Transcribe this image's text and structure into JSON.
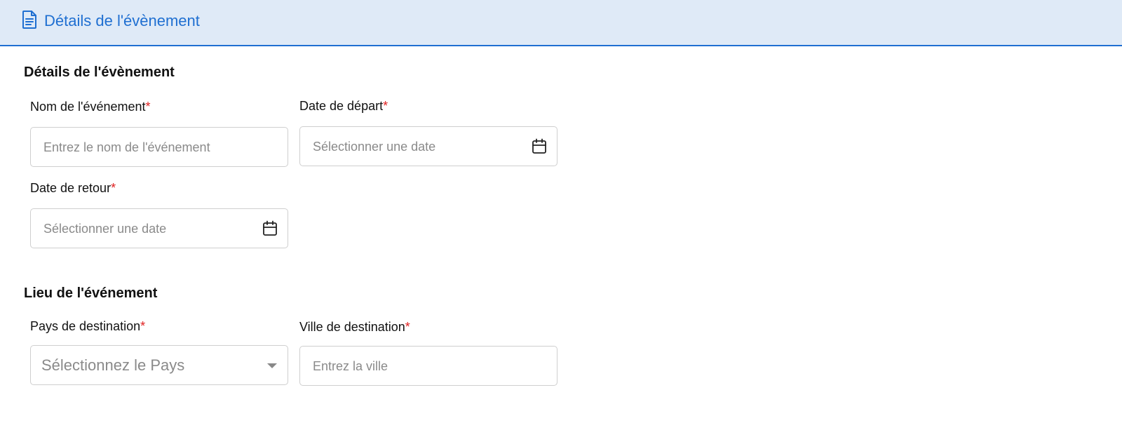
{
  "header": {
    "title": "Détails de l'évènement",
    "icon": "document-icon"
  },
  "sections": {
    "details": {
      "title": "Détails de l'évènement",
      "event_name": {
        "label": "Nom de l'événement",
        "required": "*",
        "placeholder": "Entrez le nom de l'événement"
      },
      "departure_date": {
        "label": "Date de départ",
        "required": "*",
        "placeholder": "Sélectionner une date"
      },
      "return_date": {
        "label": "Date de retour",
        "required": "*",
        "placeholder": "Sélectionner une date"
      }
    },
    "location": {
      "title": "Lieu de l'événement",
      "country": {
        "label": "Pays de destination",
        "required": "*",
        "placeholder": "Sélectionnez le Pays"
      },
      "city": {
        "label": "Ville de destination",
        "required": "*",
        "placeholder": "Entrez la ville"
      }
    }
  },
  "colors": {
    "accent": "#1f6fd1",
    "header_bg": "#dfeaf7",
    "required": "#e02020"
  }
}
